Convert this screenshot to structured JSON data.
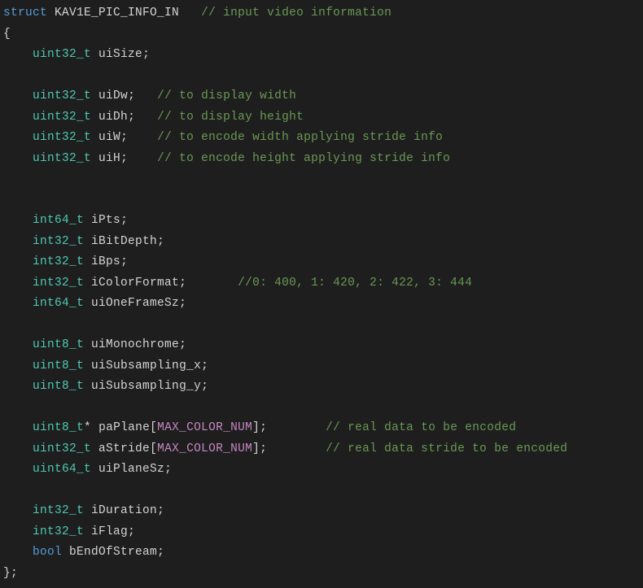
{
  "line1": {
    "kw": "struct",
    "name": "KAV1E_PIC_INFO_IN",
    "cmt": "// input video information"
  },
  "brace_open": "{",
  "uiSize": {
    "type": "uint32_t",
    "name": "uiSize",
    "semi": ";"
  },
  "uiDw": {
    "type": "uint32_t",
    "name": "uiDw",
    "semi": ";",
    "cmt": "// to display width"
  },
  "uiDh": {
    "type": "uint32_t",
    "name": "uiDh",
    "semi": ";",
    "cmt": "// to display height"
  },
  "uiW": {
    "type": "uint32_t",
    "name": "uiW",
    "semi": ";",
    "cmt": "// to encode width applying stride info"
  },
  "uiH": {
    "type": "uint32_t",
    "name": "uiH",
    "semi": ";",
    "cmt": "// to encode height applying stride info"
  },
  "iPts": {
    "type": "int64_t",
    "name": "iPts",
    "semi": ";"
  },
  "iBitDepth": {
    "type": "int32_t",
    "name": "iBitDepth",
    "semi": ";"
  },
  "iBps": {
    "type": "int32_t",
    "name": "iBps",
    "semi": ";"
  },
  "iColorFormat": {
    "type": "int32_t",
    "name": "iColorFormat",
    "semi": ";",
    "cmt": "//0: 400, 1: 420, 2: 422, 3: 444"
  },
  "uiOneFrameSz": {
    "type": "int64_t",
    "name": "uiOneFrameSz",
    "semi": ";"
  },
  "uiMonochrome": {
    "type": "uint8_t",
    "name": "uiMonochrome",
    "semi": ";"
  },
  "uiSubX": {
    "type": "uint8_t",
    "name": "uiSubsampling_x",
    "semi": ";"
  },
  "uiSubY": {
    "type": "uint8_t",
    "name": "uiSubsampling_y",
    "semi": ";"
  },
  "paPlane": {
    "type": "uint8_t",
    "star": "*",
    "name": "paPlane",
    "lbr": "[",
    "macro": "MAX_COLOR_NUM",
    "rbr": "]",
    "semi": ";",
    "cmt": "// real data to be encoded"
  },
  "aStride": {
    "type": "uint32_t",
    "name": "aStride",
    "lbr": "[",
    "macro": "MAX_COLOR_NUM",
    "rbr": "]",
    "semi": ";",
    "cmt": "// real data stride to be encoded"
  },
  "uiPlaneSz": {
    "type": "uint64_t",
    "name": "uiPlaneSz",
    "semi": ";"
  },
  "iDuration": {
    "type": "int32_t",
    "name": "iDuration",
    "semi": ";"
  },
  "iFlag": {
    "type": "int32_t",
    "name": "iFlag",
    "semi": ";"
  },
  "bEnd": {
    "type": "bool",
    "name": "bEndOfStream",
    "semi": ";"
  },
  "brace_close": "};"
}
